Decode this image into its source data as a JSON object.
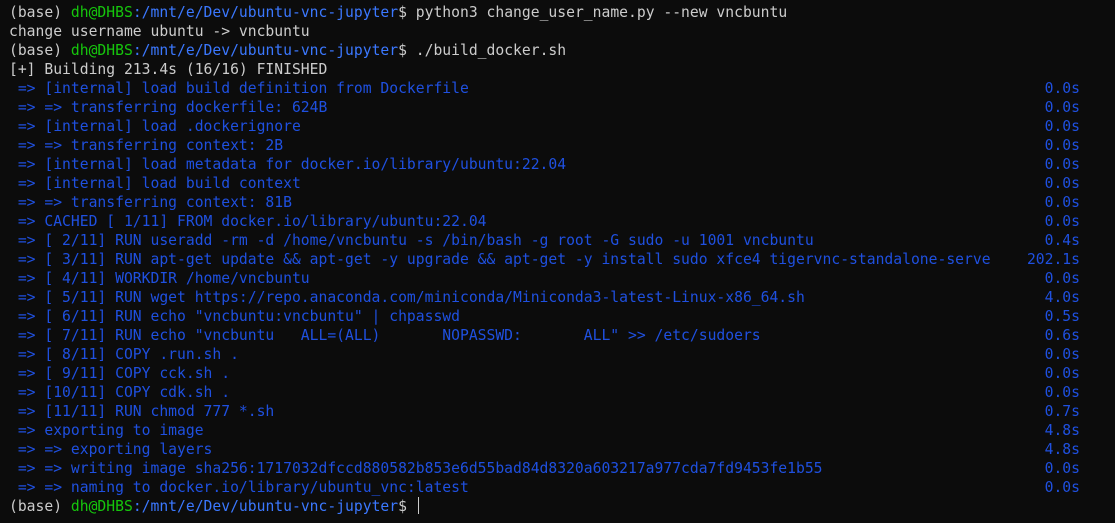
{
  "prompt": {
    "env": "(base)",
    "user": "dh@DHBS",
    "path": ":/mnt/e/Dev/ubuntu-vnc-jupyter",
    "dollar": "$"
  },
  "cmd1": "python3 change_user_name.py --new vncbuntu",
  "out1": "change username ubuntu -> vncbuntu",
  "cmd2": "./build_docker.sh",
  "building": "[+] Building 213.4s (16/16) FINISHED",
  "steps": [
    {
      "text": " => [internal] load build definition from Dockerfile",
      "time": "0.0s"
    },
    {
      "text": " => => transferring dockerfile: 624B",
      "time": "0.0s"
    },
    {
      "text": " => [internal] load .dockerignore",
      "time": "0.0s"
    },
    {
      "text": " => => transferring context: 2B",
      "time": "0.0s"
    },
    {
      "text": " => [internal] load metadata for docker.io/library/ubuntu:22.04",
      "time": "0.0s"
    },
    {
      "text": " => [internal] load build context",
      "time": "0.0s"
    },
    {
      "text": " => => transferring context: 81B",
      "time": "0.0s"
    },
    {
      "text": " => CACHED [ 1/11] FROM docker.io/library/ubuntu:22.04",
      "time": "0.0s"
    },
    {
      "text": " => [ 2/11] RUN useradd -rm -d /home/vncbuntu -s /bin/bash -g root -G sudo -u 1001 vncbuntu",
      "time": "0.4s"
    },
    {
      "text": " => [ 3/11] RUN apt-get update && apt-get -y upgrade && apt-get -y install sudo xfce4 tigervnc-standalone-serve",
      "time": "202.1s"
    },
    {
      "text": " => [ 4/11] WORKDIR /home/vncbuntu",
      "time": "0.0s"
    },
    {
      "text": " => [ 5/11] RUN wget https://repo.anaconda.com/miniconda/Miniconda3-latest-Linux-x86_64.sh",
      "time": "4.0s"
    },
    {
      "text": " => [ 6/11] RUN echo \"vncbuntu:vncbuntu\" | chpasswd",
      "time": "0.5s"
    },
    {
      "text": " => [ 7/11] RUN echo \"vncbuntu   ALL=(ALL)       NOPASSWD:       ALL\" >> /etc/sudoers",
      "time": "0.6s"
    },
    {
      "text": " => [ 8/11] COPY .run.sh .",
      "time": "0.0s"
    },
    {
      "text": " => [ 9/11] COPY cck.sh .",
      "time": "0.0s"
    },
    {
      "text": " => [10/11] COPY cdk.sh .",
      "time": "0.0s"
    },
    {
      "text": " => [11/11] RUN chmod 777 *.sh",
      "time": "0.7s"
    },
    {
      "text": " => exporting to image",
      "time": "4.8s"
    },
    {
      "text": " => => exporting layers",
      "time": "4.8s"
    },
    {
      "text": " => => writing image sha256:1717032dfccd880582b853e6d55bad84d8320a603217a977cda7fd9453fe1b55",
      "time": "0.0s"
    },
    {
      "text": " => => naming to docker.io/library/ubuntu_vnc:latest",
      "time": "0.0s"
    }
  ]
}
